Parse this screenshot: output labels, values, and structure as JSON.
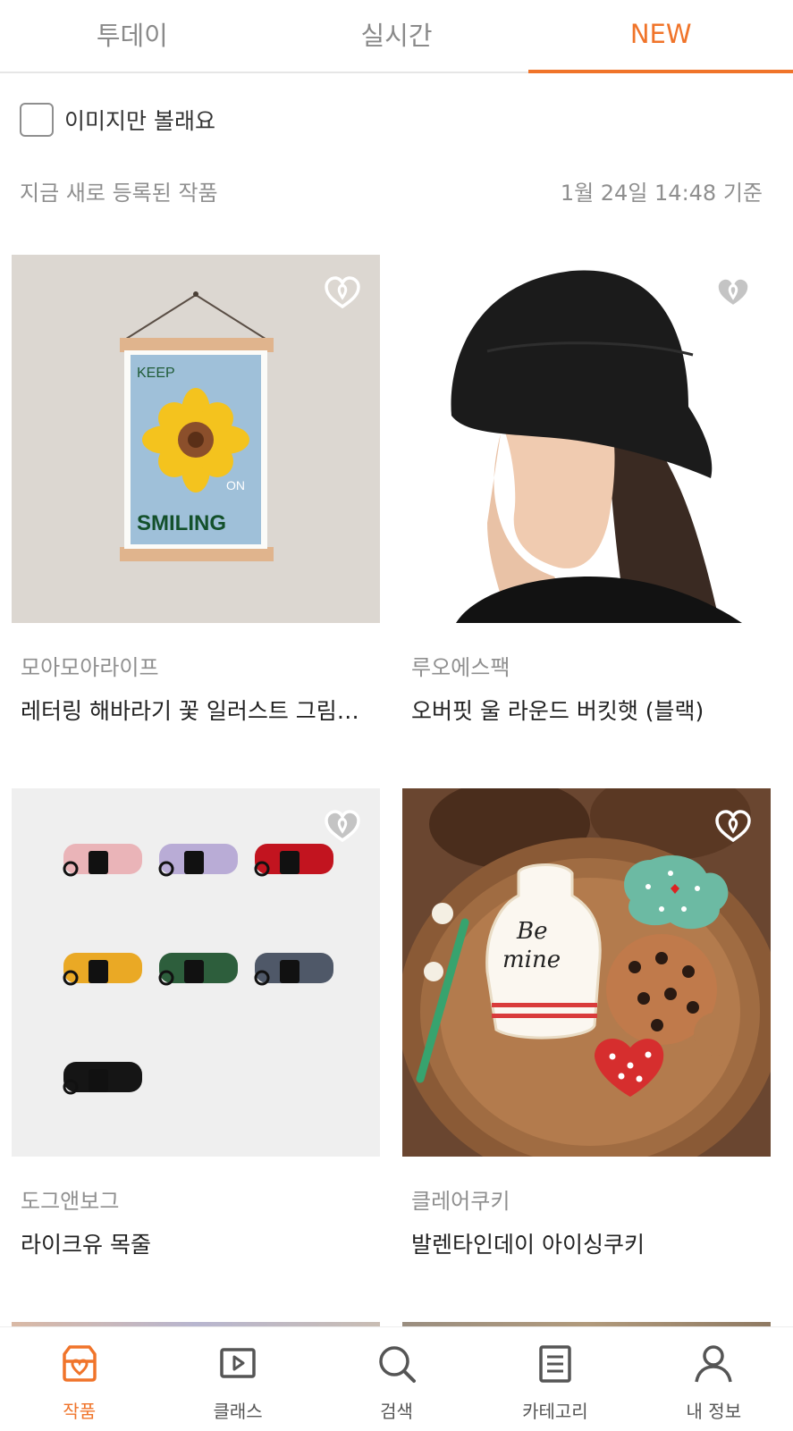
{
  "tabs": [
    {
      "label": "투데이",
      "active": false
    },
    {
      "label": "실시간",
      "active": false
    },
    {
      "label": "NEW",
      "active": true
    }
  ],
  "filter": {
    "image_only_label": "이미지만 볼래요",
    "checked": false
  },
  "section": {
    "title": "지금 새로 등록된 작품",
    "timestamp": "1월 24일 14:48 기준"
  },
  "products": [
    {
      "artist": "모아모아라이프",
      "title": "레터링 해바라기 꽃 일러스트 그림 ...",
      "image": "sunflower-poster-image",
      "poster_top": "KEEP",
      "poster_mid": "ON",
      "poster_bottom": "SMILING"
    },
    {
      "artist": "루오에스팩",
      "title": "오버핏 울 라운드 버킷햇 (블랙)",
      "image": "black-bucket-hat-image"
    },
    {
      "artist": "도그앤보그",
      "title": "라이크유 목줄",
      "image": "dog-collars-image"
    },
    {
      "artist": "클레어쿠키",
      "title": "발렌타인데이 아이싱쿠키",
      "image": "icing-cookies-image",
      "cookie_text_1": "Be",
      "cookie_text_2": "mine"
    }
  ],
  "bottom_nav": [
    {
      "label": "작품",
      "icon": "shop-icon",
      "active": true
    },
    {
      "label": "클래스",
      "icon": "play-board-icon",
      "active": false
    },
    {
      "label": "검색",
      "icon": "search-icon",
      "active": false
    },
    {
      "label": "카테고리",
      "icon": "list-icon",
      "active": false
    },
    {
      "label": "내 정보",
      "icon": "person-icon",
      "active": false
    }
  ],
  "colors": {
    "accent": "#f0742a",
    "muted": "#8f8f8f",
    "text": "#222222"
  }
}
